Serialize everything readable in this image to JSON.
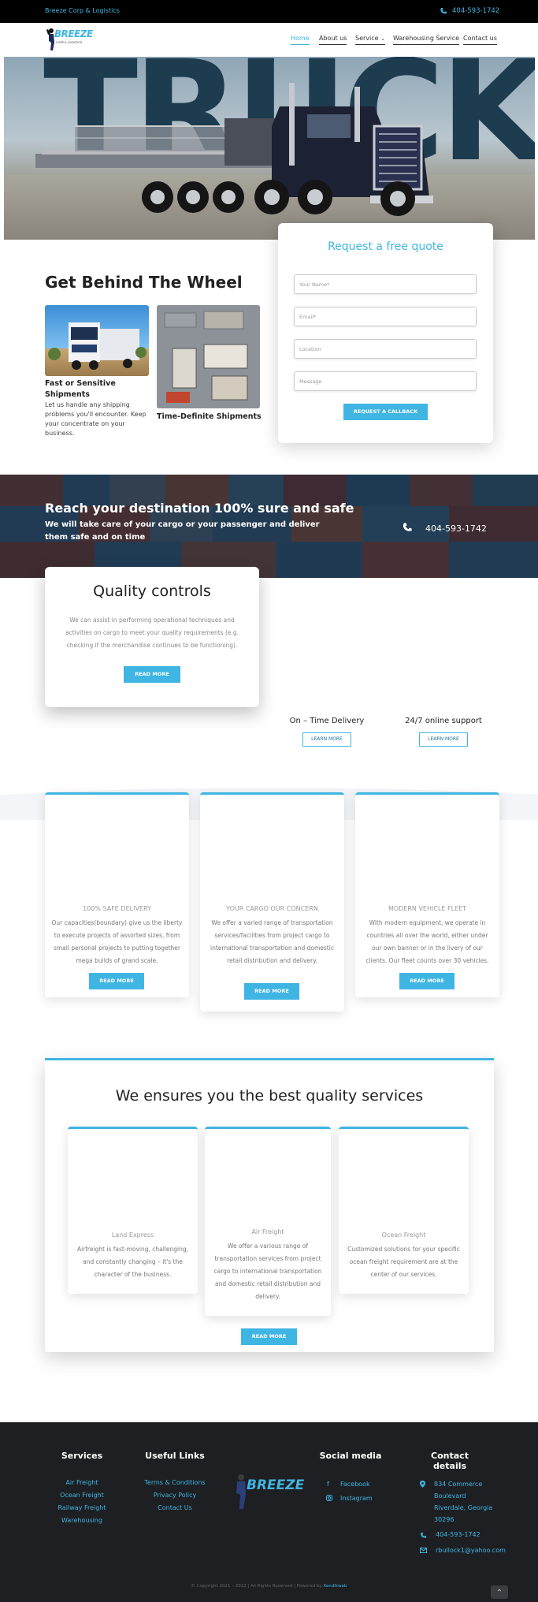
{
  "topbar": {
    "brand": "Breeze Corp & Logistics",
    "phone": "404-593-1742"
  },
  "logo": {
    "text": "BREEZE",
    "sub": "CORP & LOGISTICS"
  },
  "nav": {
    "items": [
      "Home",
      "About us",
      "Service",
      "Warehousing Service",
      "Contact us"
    ],
    "service_chevron": "⌄"
  },
  "hero": {
    "word": "TRUCK"
  },
  "section1": {
    "title": "Get Behind The Wheel",
    "card1": {
      "title": "Fast or Sensitive Shipments",
      "text": "Let us handle any shipping problems you'll encounter. Keep your concentrate on your business."
    },
    "card2": {
      "title": "Time-Definite Shipments"
    }
  },
  "quote": {
    "title": "Request a free quote",
    "name_placeholder": "Your Name*",
    "email_placeholder": "Email*",
    "location_placeholder": "Location",
    "message_placeholder": "Message",
    "button": "REQUEST A CALLBACK"
  },
  "banner": {
    "title": "Reach your destination 100% sure and safe",
    "subtitle": "We will take care of your cargo or your passenger and deliver them safe and on time",
    "phone": "404-593-1742"
  },
  "quality": {
    "title": "Quality controls",
    "text": "We can assist in performing operational techniques and activities on cargo to meet your quality requirements (e.g. checking if the merchandise continues to be functioning).",
    "button": "READ MORE"
  },
  "side_features": [
    {
      "title": "On – Time Delivery",
      "button": "LEARN MORE"
    },
    {
      "title": "24/7 online support",
      "button": "LEARN MORE"
    }
  ],
  "features": [
    {
      "title": "100% SAFE DELIVERY",
      "text": "Our capacities(boundary) give us the liberty to execute projects of assorted sizes, from small personal projects to putting together mega builds of grand scale.",
      "button": "READ MORE"
    },
    {
      "title": "YOUR CARGO OUR CONCERN",
      "text": "We offer a varied range of transportation services/facilities from project cargo to international transportation and domestic retail distribution and delivery.",
      "button": "READ MORE"
    },
    {
      "title": "MODERN VEHICLE FLEET",
      "text": "With modern equipment, we operate in countries all over the world, either under our own banner or in the livery of our clients. Our fleet counts over 30 vehicles.",
      "button": "READ MORE"
    }
  ],
  "services": {
    "title": "We ensures you the best quality services",
    "items": [
      {
        "title": "Land Express",
        "text": "Airfreight is fast-moving, challenging, and constantly changing – it's the character of the business."
      },
      {
        "title": "Air Freight",
        "text": "We offer a various range of transportation services from project cargo to international transportation and domestic retail distribution and delivery."
      },
      {
        "title": "Ocean Freight",
        "text": "Customized solutions for your specific ocean freight requirement are at the center of our services."
      }
    ],
    "button": "READ MORE"
  },
  "footer": {
    "services_title": "Services",
    "services": [
      "Air Freight",
      "Ocean Freight",
      "Railway Freight",
      "Warehousing"
    ],
    "links_title": "Useful Links",
    "links": [
      "Terms & Conditions",
      "Privacy Policy",
      "Contact Us"
    ],
    "logo": "BREEZE",
    "social_title": "Social media",
    "social": [
      "Facebook",
      "Instagram"
    ],
    "contact_title": "Contact details",
    "address": [
      "834 Commerce",
      "Boulevard",
      "Riverdale, Georgia",
      "30296"
    ],
    "phone": "404-593-1742",
    "email": "rbullock1@yahoo.com",
    "copyright": "© Copyright 2021 – 2022 | All Rights Reserved | Powered by",
    "powered": "Xendikweb",
    "scroll_top": "⌃"
  },
  "colors": {
    "accent": "#3fb5e3",
    "dark": "#1d1f22"
  }
}
